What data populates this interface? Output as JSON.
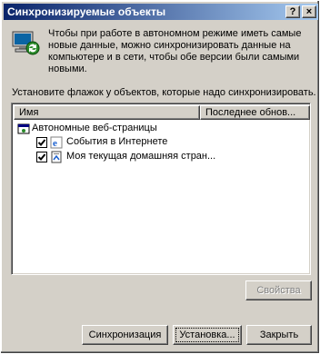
{
  "window": {
    "title": "Синхронизируемые объекты",
    "help_label": "?",
    "close_label": "×"
  },
  "description": "Чтобы при работе в автономном режиме иметь самые новые данные, можно синхронизировать данные на компьютере и в сети, чтобы обе версии были самыми новыми.",
  "instruction": "Установите флажок у объектов, которые надо синхронизировать.",
  "list": {
    "columns": {
      "name": "Имя",
      "last_updated": "Последнее обнов..."
    },
    "group": "Автономные веб-страницы",
    "items": [
      {
        "label": "События в Интернете",
        "checked": true
      },
      {
        "label": "Моя текущая домашняя стран...",
        "checked": true
      }
    ]
  },
  "buttons": {
    "properties": "Свойства",
    "sync": "Синхронизация",
    "setup": "Установка...",
    "close": "Закрыть"
  }
}
